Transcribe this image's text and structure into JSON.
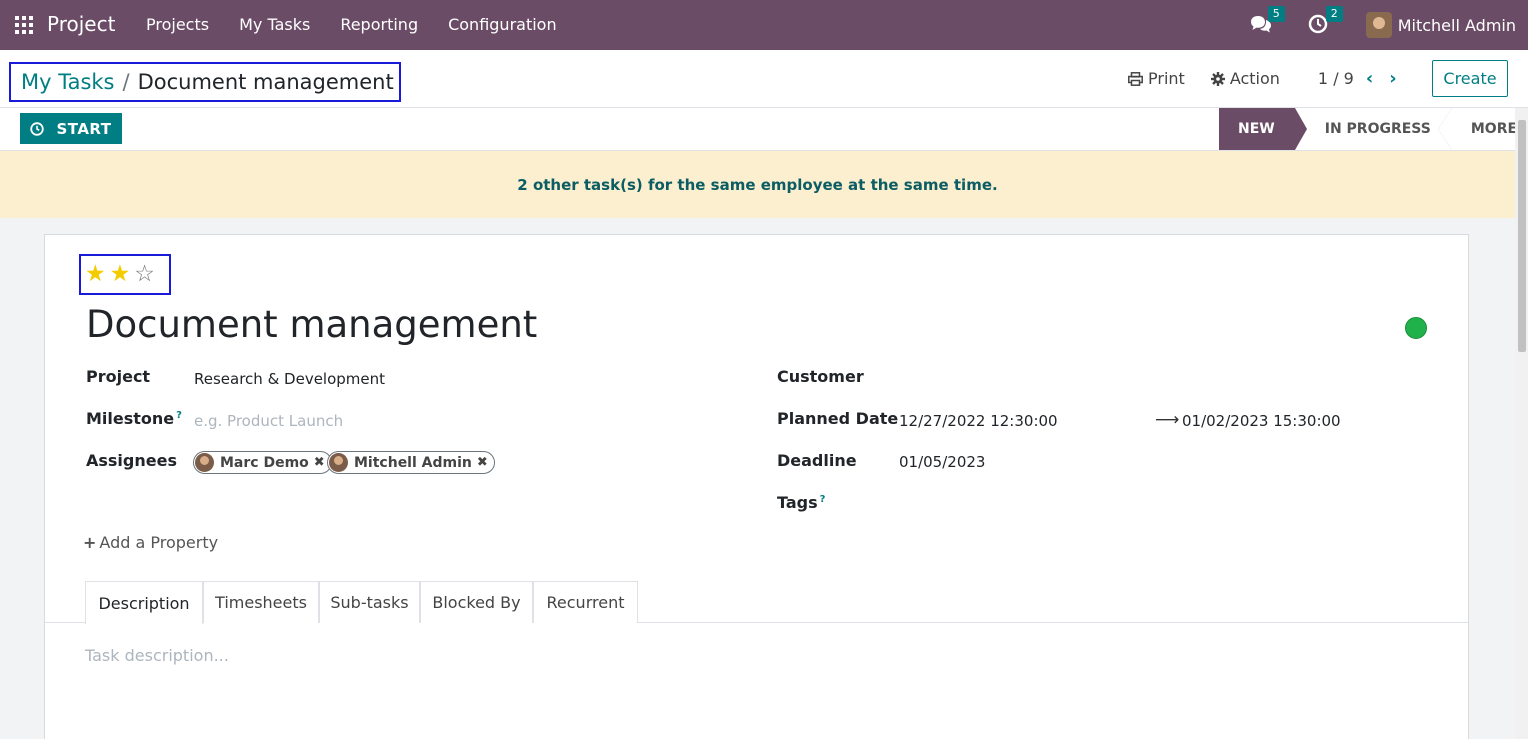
{
  "navbar": {
    "app_name": "Project",
    "menu": [
      "Projects",
      "My Tasks",
      "Reporting",
      "Configuration"
    ],
    "messages_count": "5",
    "activities_count": "2",
    "user_name": "Mitchell Admin"
  },
  "breadcrumb": {
    "parent": "My Tasks",
    "separator": "/",
    "current": "Document management"
  },
  "control_panel": {
    "print_label": "Print",
    "action_label": "Action",
    "pager_value": "1 / 9",
    "create_label": "Create"
  },
  "statusbar": {
    "start_label": "START",
    "stages": [
      "NEW",
      "IN PROGRESS",
      "MORE"
    ],
    "active_stage": "NEW"
  },
  "alert": {
    "text": "2 other task(s) for the same employee at the same time."
  },
  "form": {
    "priority": {
      "value": 2,
      "max": 3
    },
    "title": "Document management",
    "kanban_state_color": "#21b14b",
    "left_fields": {
      "project_label": "Project",
      "project_value": "Research & Development",
      "milestone_label": "Milestone",
      "milestone_tooltip": "?",
      "milestone_placeholder": "e.g. Product Launch",
      "assignees_label": "Assignees",
      "assignees": [
        "Marc Demo",
        "Mitchell Admin"
      ]
    },
    "right_fields": {
      "customer_label": "Customer",
      "planned_date_label": "Planned Date",
      "planned_start": "12/27/2022 12:30:00",
      "planned_end": "01/02/2023 15:30:00",
      "deadline_label": "Deadline",
      "deadline_value": "01/05/2023",
      "tags_label": "Tags",
      "tags_tooltip": "?"
    },
    "add_property_label": "Add a Property",
    "tabs": [
      "Description",
      "Timesheets",
      "Sub-tasks",
      "Blocked By",
      "Recurrent"
    ],
    "active_tab": "Description",
    "description_placeholder": "Task description..."
  },
  "colors": {
    "navbar": "#6b4c66",
    "accent": "#017e84",
    "alert_bg": "#fbefd0",
    "highlight_border": "#1a1adb"
  }
}
